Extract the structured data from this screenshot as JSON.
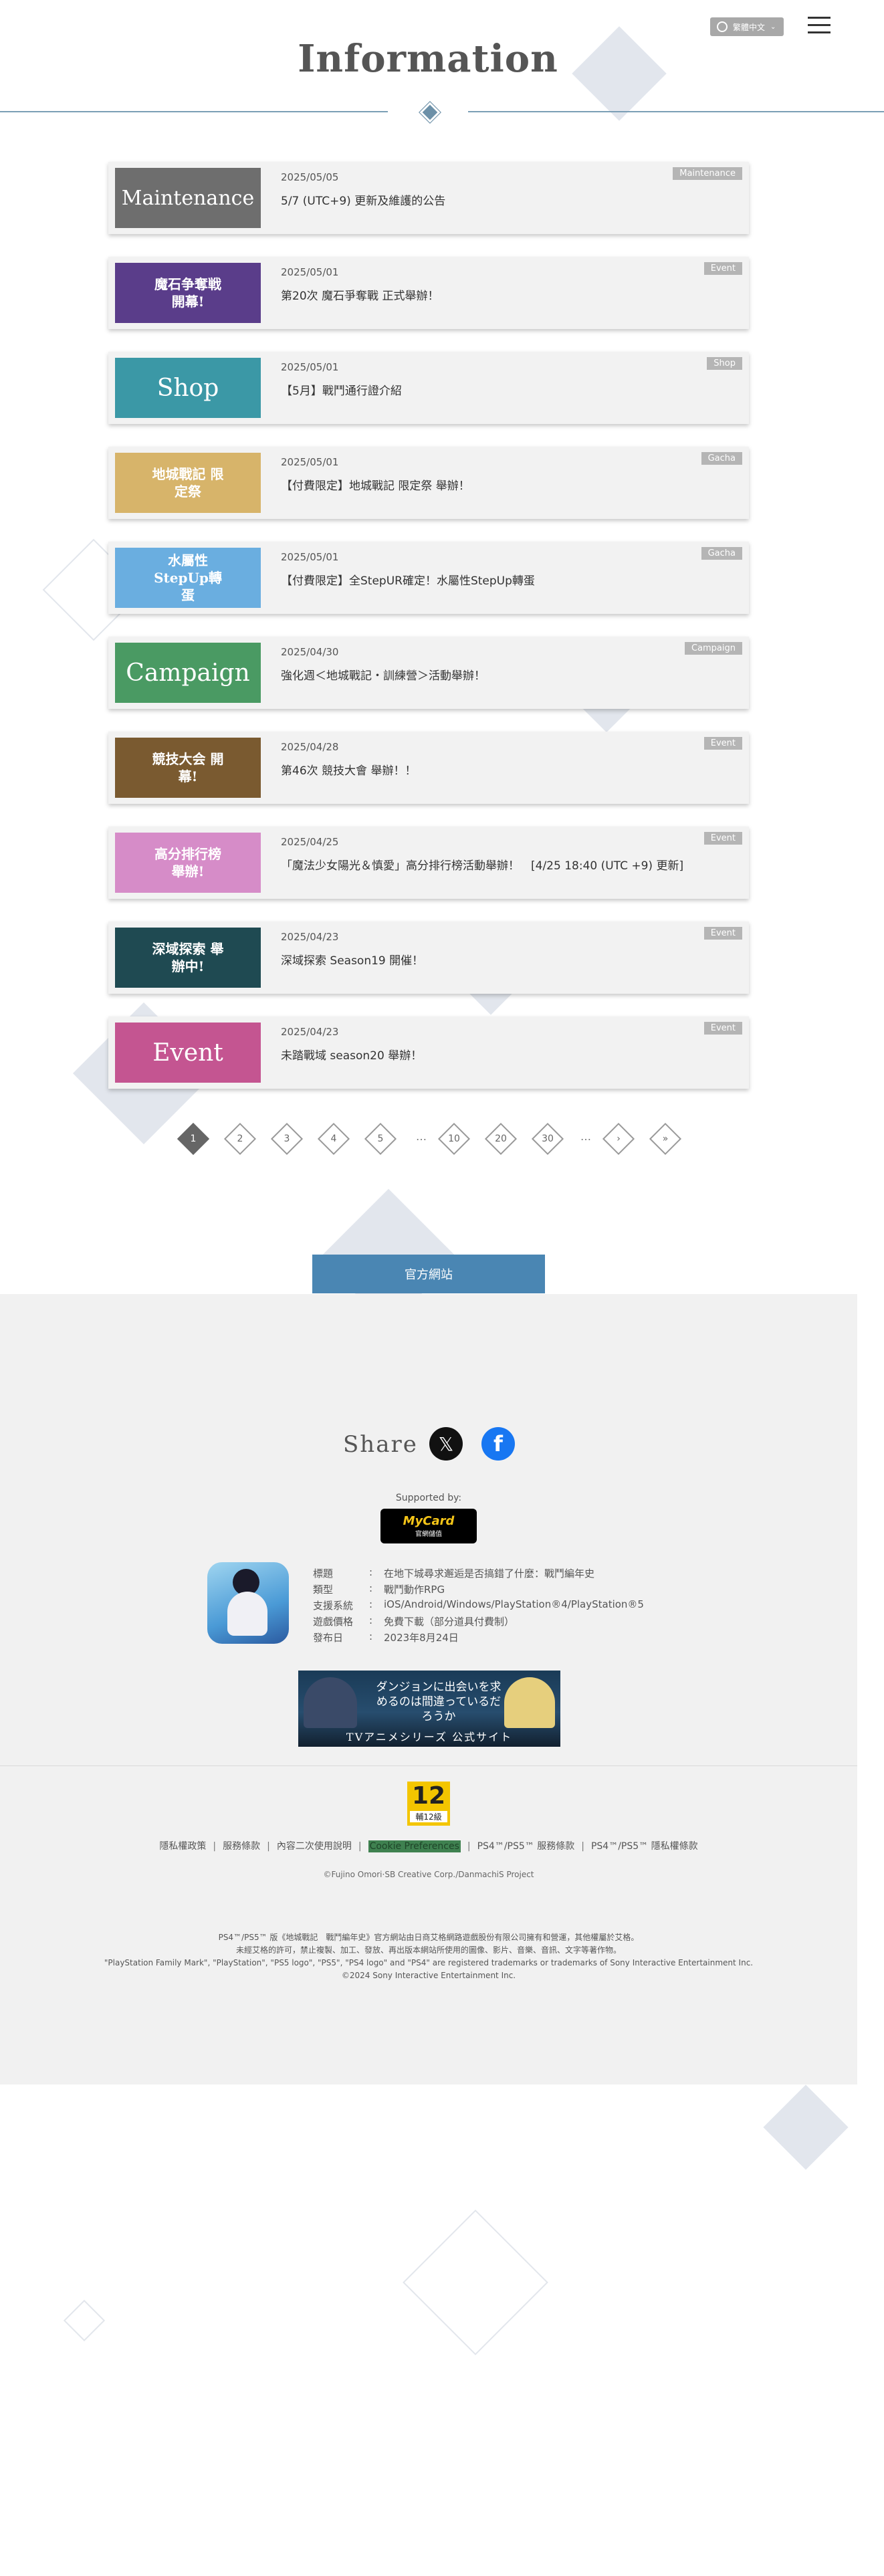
{
  "header": {
    "lang_label": "繁體中文",
    "page_title": "Information"
  },
  "news": [
    {
      "date": "2025/05/05",
      "title": "5/7 (UTC+9) 更新及維護的公告",
      "badge": "Maintenance",
      "thumb_text": "Maintenance",
      "thumb_color": "#6e6e6e"
    },
    {
      "date": "2025/05/01",
      "title": "第20次 魔石爭奪戰 正式舉辦！",
      "badge": "Event",
      "thumb_text": "魔石争奪戦 開幕!",
      "thumb_color": "#5a3d8a"
    },
    {
      "date": "2025/05/01",
      "title": "【5月】戰鬥通行證介紹",
      "badge": "Shop",
      "thumb_text": "Shop",
      "thumb_color": "#3b98a6"
    },
    {
      "date": "2025/05/01",
      "title": "【付費限定】地城戰記 限定祭 舉辦！",
      "badge": "Gacha",
      "thumb_text": "地城戰記 限定祭",
      "thumb_color": "#d7b46a"
    },
    {
      "date": "2025/05/01",
      "title": "【付費限定】全StepUR確定！水屬性StepUp轉蛋",
      "badge": "Gacha",
      "thumb_text": "水屬性 StepUp轉蛋",
      "thumb_color": "#6aaee0"
    },
    {
      "date": "2025/04/30",
      "title": "強化週＜地城戰記・訓練營＞活動舉辦！",
      "badge": "Campaign",
      "thumb_text": "Campaign",
      "thumb_color": "#4a9a63"
    },
    {
      "date": "2025/04/28",
      "title": "第46次 競技大會 舉辦！！",
      "badge": "Event",
      "thumb_text": "競技大会 開幕!",
      "thumb_color": "#7a5a30"
    },
    {
      "date": "2025/04/25",
      "title": "「魔法少女陽光＆慎愛」高分排行榜活動舉辦！　[4/25 18:40 (UTC +9) 更新]",
      "badge": "Event",
      "thumb_text": "高分排行榜 舉辦!",
      "thumb_color": "#d68cc8"
    },
    {
      "date": "2025/04/23",
      "title": "深域探索 Season19 開催！",
      "badge": "Event",
      "thumb_text": "深域探索 舉辦中!",
      "thumb_color": "#1f4a52"
    },
    {
      "date": "2025/04/23",
      "title": "未踏戰域 season20 舉辦！",
      "badge": "Event",
      "thumb_text": "Event",
      "thumb_color": "#c45591"
    }
  ],
  "pagination": [
    "1",
    "2",
    "3",
    "4",
    "5",
    "…",
    "10",
    "20",
    "30",
    "…",
    "›",
    "»"
  ],
  "official_button": "官方網站",
  "footer": {
    "share_label": "Share",
    "supported_by": "Supported by:",
    "mycard_label": "MyCard",
    "mycard_sub": "官網儲值",
    "game_info": [
      {
        "key": "標題",
        "value": "在地下城尋求邂逅是否搞錯了什麼：戰鬥編年史"
      },
      {
        "key": "類型",
        "value": "戰鬥動作RPG"
      },
      {
        "key": "支援系統",
        "value": "iOS/Android/Windows/PlayStation®4/PlayStation®5"
      },
      {
        "key": "遊戲價格",
        "value": "免費下載（部分道具付費制）"
      },
      {
        "key": "發布日",
        "value": "2023年8月24日"
      }
    ],
    "tv_banner_text": "ダンジョンに出会いを求めるのは間違っているだろうか",
    "tv_banner_sub": "TVアニメシリーズ 公式サイト",
    "rating_age": "12",
    "rating_label": "輔12級",
    "links": [
      "隱私權政策",
      "服務條款",
      "內容二次使用說明",
      "Cookie Preferences",
      "PS4™/PS5™ 服務條款",
      "PS4™/PS5™ 隱私權條款"
    ],
    "copyright": "©Fujino Omori·SB Creative Corp./DanmachiS Project",
    "legal": [
      "PS4™/PS5™ 版《地城戰記　戰鬥編年史》官方網站由日商艾格網路遊戲股份有限公司擁有和營運，其他權屬於艾格。",
      "未經艾格的許可，禁止複製、加工、發放、再出版本網站所使用的圖像、影片、音樂、音訊、文字等著作物。",
      "\"PlayStation Family Mark\", \"PlayStation\", \"PS5 logo\", \"PS5\", \"PS4 logo\" and \"PS4\" are registered trademarks or trademarks of Sony Interactive Entertainment Inc.",
      "©2024 Sony Interactive Entertainment Inc."
    ]
  }
}
